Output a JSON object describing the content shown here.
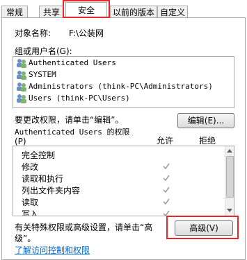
{
  "tabs": [
    {
      "label": "常规"
    },
    {
      "label": "共享"
    },
    {
      "label": "安全"
    },
    {
      "label": "以前的版本"
    },
    {
      "label": "自定义"
    }
  ],
  "object": {
    "label": "对象名称:",
    "value": "F:\\公装网"
  },
  "groups": {
    "label": "组或用户名(G):",
    "items": [
      {
        "name": "Authenticated Users"
      },
      {
        "name": "SYSTEM"
      },
      {
        "name": "Administrators (think-PC\\Administrators)"
      },
      {
        "name": "Users (think-PC\\Users)"
      }
    ]
  },
  "change_hint": "要更改权限，请单击“编辑”。",
  "edit_button": "编辑(E)...",
  "permissions": {
    "title": "Authenticated Users 的权限",
    "title2": "(P)",
    "allow_header": "允许",
    "deny_header": "拒绝",
    "items": [
      {
        "name": "完全控制",
        "allow": false
      },
      {
        "name": "修改",
        "allow": true
      },
      {
        "name": "读取和执行",
        "allow": true
      },
      {
        "name": "列出文件夹内容",
        "allow": true
      },
      {
        "name": "读取",
        "allow": true
      },
      {
        "name": "写入",
        "allow": true
      }
    ]
  },
  "advanced_hint": "有关特殊权限或高级设置，请单击“高级”。",
  "advanced_hint_l1": "有关特殊权限或高级设置，请单击“高",
  "advanced_hint_l2": "级”。",
  "advanced_button": "高级(V)",
  "learn_link": "了解访问控制和权限",
  "colors": {
    "highlight": "#e8252b",
    "link": "#0066cc",
    "check": "#a0a0a0"
  }
}
